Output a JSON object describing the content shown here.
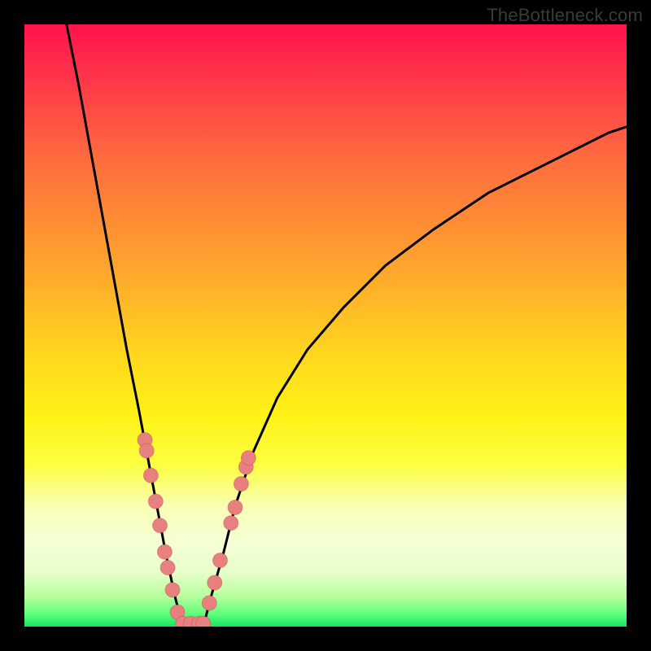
{
  "watermark": "TheBottleneck.com",
  "chart_data": {
    "type": "line",
    "title": "",
    "xlabel": "",
    "ylabel": "",
    "xlim": [
      0,
      100
    ],
    "ylim": [
      0,
      100
    ],
    "grid": false,
    "series": [
      {
        "name": "left_curve",
        "x": [
          7,
          9,
          11,
          13,
          15,
          17,
          19,
          20.5,
          22,
          23.5,
          25,
          26.3
        ],
        "y": [
          100,
          90,
          79,
          68,
          57,
          46,
          36,
          28,
          20,
          12,
          5,
          0
        ]
      },
      {
        "name": "right_curve",
        "x": [
          29.7,
          31,
          33,
          35,
          38,
          42,
          47,
          53,
          60,
          68,
          77,
          87,
          97,
          100
        ],
        "y": [
          0,
          5,
          12,
          20,
          29,
          38,
          46,
          53,
          60,
          66,
          72,
          77,
          82,
          83
        ]
      }
    ],
    "markers": [
      {
        "x": 20.0,
        "y": 31.0
      },
      {
        "x": 20.3,
        "y": 29.2
      },
      {
        "x": 21.0,
        "y": 25.1
      },
      {
        "x": 21.8,
        "y": 20.8
      },
      {
        "x": 22.5,
        "y": 16.8
      },
      {
        "x": 23.3,
        "y": 12.4
      },
      {
        "x": 23.8,
        "y": 9.8
      },
      {
        "x": 24.6,
        "y": 6.1
      },
      {
        "x": 25.4,
        "y": 2.4
      },
      {
        "x": 26.3,
        "y": 0.5
      },
      {
        "x": 27.6,
        "y": 0.5
      },
      {
        "x": 29.0,
        "y": 0.5
      },
      {
        "x": 29.7,
        "y": 0.5
      },
      {
        "x": 30.7,
        "y": 3.9
      },
      {
        "x": 31.6,
        "y": 7.3
      },
      {
        "x": 32.5,
        "y": 11.0
      },
      {
        "x": 34.3,
        "y": 17.2
      },
      {
        "x": 35.0,
        "y": 19.8
      },
      {
        "x": 36.0,
        "y": 23.7
      },
      {
        "x": 36.8,
        "y": 26.5
      },
      {
        "x": 37.2,
        "y": 28.0
      }
    ],
    "marker_color": "#e98080",
    "curve_color": "#000000",
    "background_gradient_stops": [
      {
        "pos": 0,
        "color": "#ff124d"
      },
      {
        "pos": 50,
        "color": "#ffd71e"
      },
      {
        "pos": 80,
        "color": "#f9ffb5"
      },
      {
        "pos": 100,
        "color": "#14e65f"
      }
    ]
  }
}
